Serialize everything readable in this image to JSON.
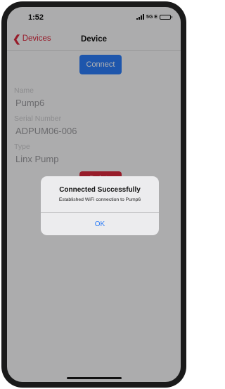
{
  "status_bar": {
    "time": "1:52",
    "network": "5G E"
  },
  "nav": {
    "back_label": "Devices",
    "title": "Device"
  },
  "device": {
    "connect_label": "Connect",
    "name_label": "Name",
    "name_value": "Pump6",
    "serial_label": "Serial Number",
    "serial_value": "ADPUM06-006",
    "type_label": "Type",
    "type_value": "Linx Pump",
    "delete_label": "Delete"
  },
  "alert": {
    "title": "Connected Successfully",
    "message": "Established WiFi connection to Pump6",
    "ok_label": "OK"
  },
  "colors": {
    "accent_red": "#d9293d",
    "accent_blue": "#2c7cf6"
  },
  "icons": {
    "back": "chevron-left-icon",
    "signal": "signal-icon",
    "battery": "battery-icon"
  }
}
